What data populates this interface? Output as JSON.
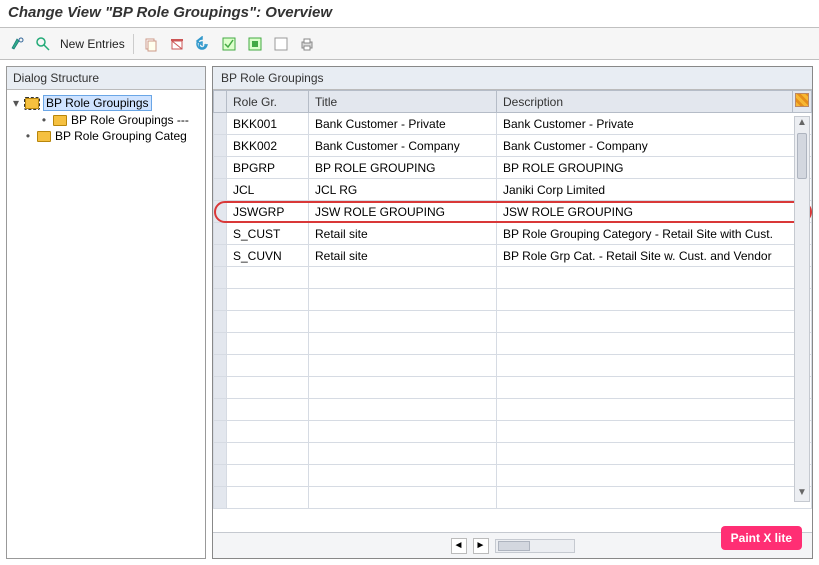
{
  "header": {
    "title": "Change View \"BP Role Groupings\": Overview"
  },
  "toolbar": {
    "new_entries_label": "New Entries"
  },
  "sidebar": {
    "title": "Dialog Structure",
    "items": [
      {
        "label": "BP Role Groupings",
        "level": 1,
        "expander": "▾",
        "selected": true
      },
      {
        "label": "BP Role Groupings ---",
        "level": 2,
        "expander": "•"
      },
      {
        "label": "BP Role Grouping Categ",
        "level": 1,
        "expander": "•"
      }
    ]
  },
  "table": {
    "title": "BP Role Groupings",
    "columns": {
      "c1": "Role Gr.",
      "c2": "Title",
      "c3": "Description"
    },
    "rows": [
      {
        "rg": "BKK001",
        "title": "Bank Customer - Private",
        "desc": "Bank Customer - Private",
        "highlight": false
      },
      {
        "rg": "BKK002",
        "title": "Bank Customer - Company",
        "desc": "Bank Customer - Company",
        "highlight": false
      },
      {
        "rg": "BPGRP",
        "title": "BP ROLE GROUPING",
        "desc": "BP ROLE GROUPING",
        "highlight": false
      },
      {
        "rg": "JCL",
        "title": "JCL RG",
        "desc": "Janiki Corp Limited",
        "highlight": false
      },
      {
        "rg": "JSWGRP",
        "title": "JSW ROLE GROUPING",
        "desc": "JSW ROLE GROUPING",
        "highlight": true
      },
      {
        "rg": "S_CUST",
        "title": "Retail site",
        "desc": "BP Role Grouping Category - Retail Site with Cust.",
        "highlight": false
      },
      {
        "rg": "S_CUVN",
        "title": "Retail site",
        "desc": "BP Role Grp Cat. - Retail Site w. Cust. and Vendor",
        "highlight": false
      }
    ],
    "empty_rows": 11
  },
  "badge": {
    "label": "Paint X lite"
  }
}
